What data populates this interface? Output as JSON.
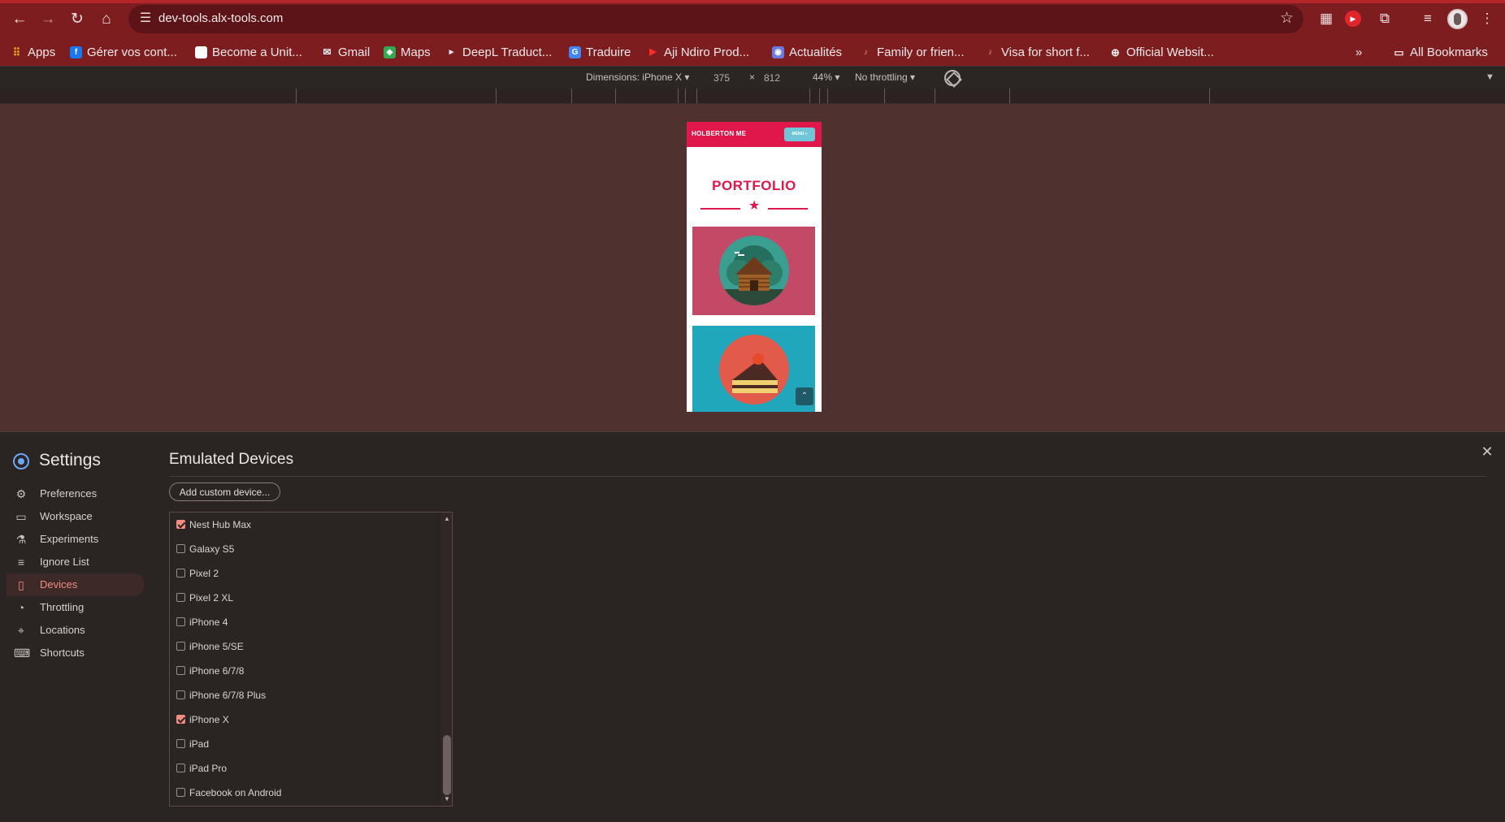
{
  "browser": {
    "url": "dev-tools.alx-tools.com",
    "bookmarks": [
      {
        "label": "Apps"
      },
      {
        "label": "Gérer vos cont..."
      },
      {
        "label": "Become a Unit..."
      },
      {
        "label": "Gmail"
      },
      {
        "label": "Maps"
      },
      {
        "label": "DeepL Traduct..."
      },
      {
        "label": "Traduire"
      },
      {
        "label": "Aji Ndiro Prod..."
      },
      {
        "label": "Actualités"
      },
      {
        "label": "Family or frien..."
      },
      {
        "label": "Visa for short f..."
      },
      {
        "label": "Official Websit..."
      }
    ],
    "overflow_chevron": "»",
    "all_bookmarks": "All Bookmarks"
  },
  "device_toolbar": {
    "dimensions_label": "Dimensions: iPhone X",
    "width": "375",
    "times": "×",
    "height": "812",
    "zoom": "44%",
    "throttling": "No throttling"
  },
  "emulated_page": {
    "brand": "HOLBERTON ME",
    "menu_button": "MENU ≡",
    "section_title": "PORTFOLIO",
    "back_to_top": "⌃"
  },
  "settings": {
    "title": "Settings",
    "nav": [
      {
        "label": "Preferences",
        "icon": "gear-icon",
        "active": false
      },
      {
        "label": "Workspace",
        "icon": "folder-icon",
        "active": false
      },
      {
        "label": "Experiments",
        "icon": "flask-icon",
        "active": false
      },
      {
        "label": "Ignore List",
        "icon": "ignore-list-icon",
        "active": false
      },
      {
        "label": "Devices",
        "icon": "devices-icon",
        "active": true
      },
      {
        "label": "Throttling",
        "icon": "gauge-icon",
        "active": false
      },
      {
        "label": "Locations",
        "icon": "location-pin-icon",
        "active": false
      },
      {
        "label": "Shortcuts",
        "icon": "keyboard-icon",
        "active": false
      }
    ],
    "pane_title": "Emulated Devices",
    "add_button": "Add custom device...",
    "devices": [
      {
        "label": "Nest Hub Max",
        "checked": true
      },
      {
        "label": "Galaxy S5",
        "checked": false
      },
      {
        "label": "Pixel 2",
        "checked": false
      },
      {
        "label": "Pixel 2 XL",
        "checked": false
      },
      {
        "label": "iPhone 4",
        "checked": false
      },
      {
        "label": "iPhone 5/SE",
        "checked": false
      },
      {
        "label": "iPhone 6/7/8",
        "checked": false
      },
      {
        "label": "iPhone 6/7/8 Plus",
        "checked": false
      },
      {
        "label": "iPhone X",
        "checked": true
      },
      {
        "label": "iPad",
        "checked": false
      },
      {
        "label": "iPad Pro",
        "checked": false
      },
      {
        "label": "Facebook on Android",
        "checked": false
      }
    ]
  },
  "colors": {
    "chrome": "#7d1d20",
    "brand_pink": "#e0174a",
    "active_accent": "#f28b82"
  }
}
